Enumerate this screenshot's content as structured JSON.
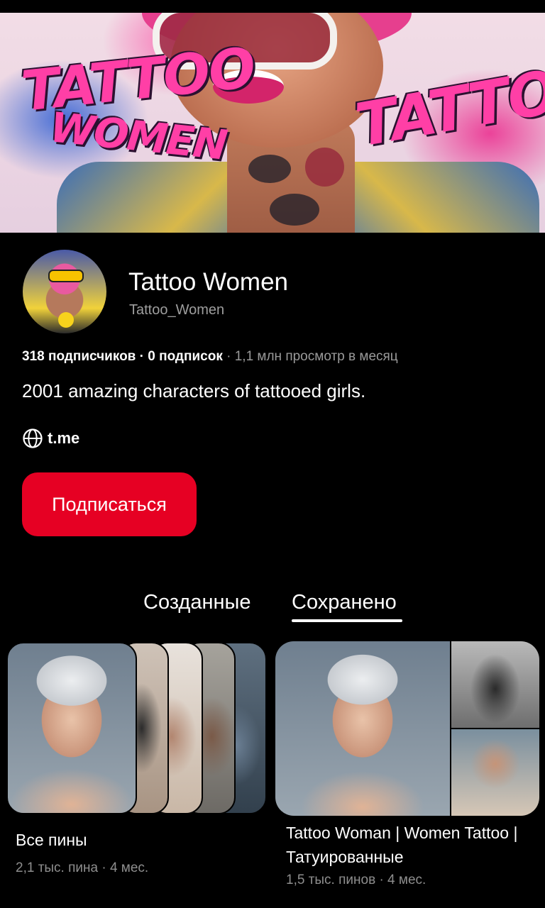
{
  "profile": {
    "name": "Tattoo Women",
    "handle": "Tattoo_Women",
    "followers": "318 подписчиков",
    "following": "0 подписок",
    "views": "1,1 млн просмотр в месяц",
    "separator": "·",
    "bio": "2001 amazing characters of tattooed girls.",
    "link": "t.me",
    "follow_button": "Подписаться"
  },
  "cover": {
    "left_title_1": "TATTOO",
    "left_title_2": "WOMEN",
    "right_title": "TATTOO"
  },
  "tabs": [
    {
      "label": "Созданные",
      "active": false
    },
    {
      "label": "Сохранено",
      "active": true
    }
  ],
  "boards": [
    {
      "title": "Все пины",
      "meta": "2,1 тыс. пина · 4 мес."
    },
    {
      "title": "Tattoo Woman | Women Tattoo | Татуированные",
      "meta": "1,5 тыс. пинов · 4 мес."
    }
  ],
  "colors": {
    "accent": "#e60023",
    "background": "#000000",
    "secondary_text": "#9e9e9e"
  },
  "icons": {
    "link": "globe-icon"
  }
}
